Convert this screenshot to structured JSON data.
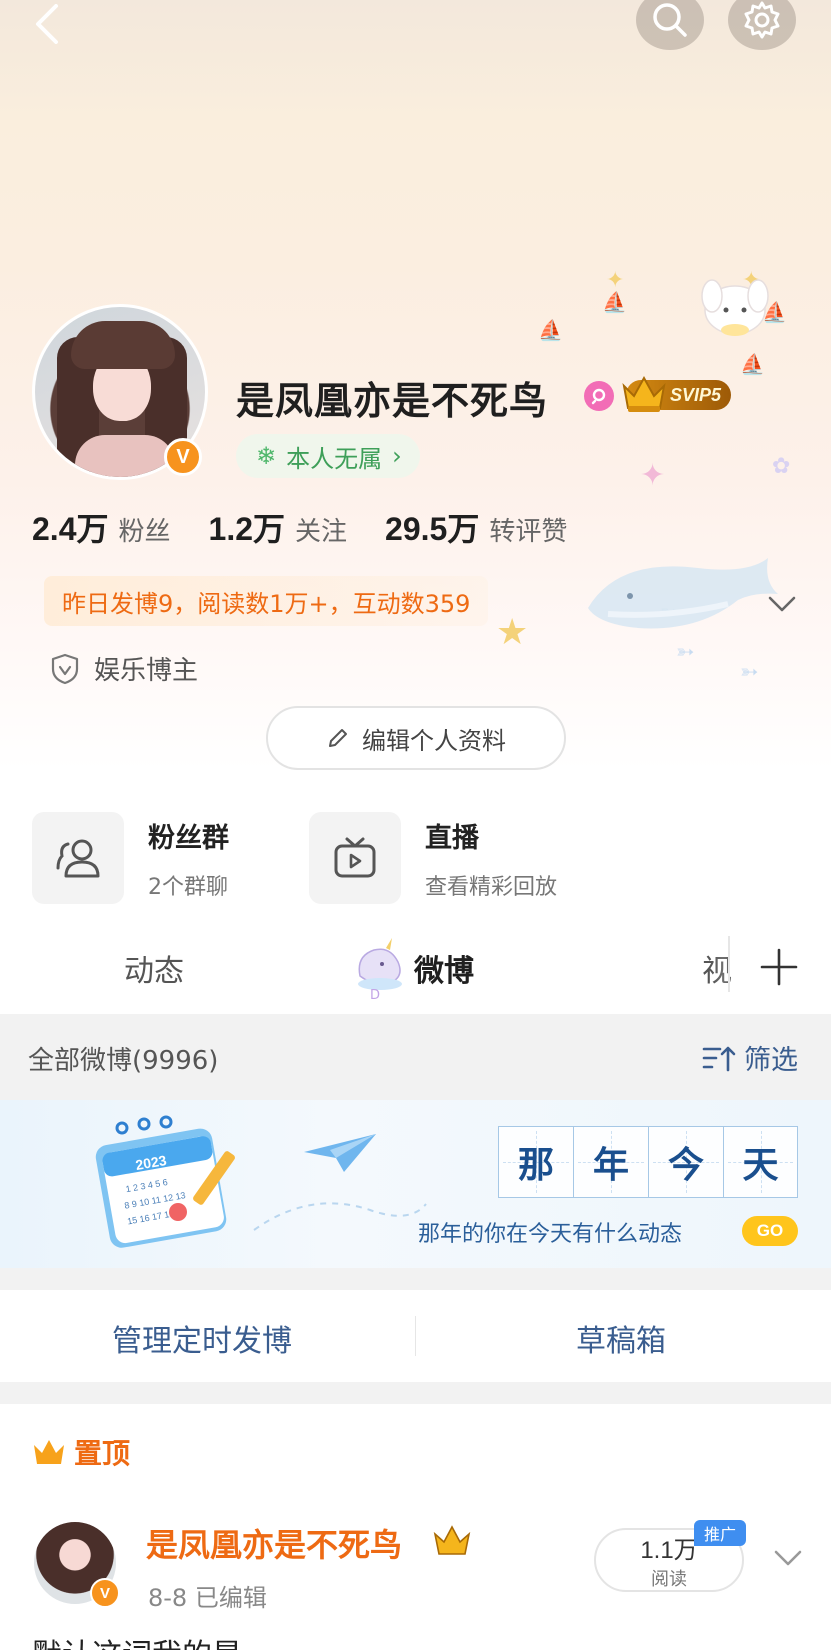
{
  "header": {
    "back_icon": "chevron-left-icon",
    "search_icon": "search-icon",
    "settings_icon": "gear-icon"
  },
  "profile": {
    "username": "是凤凰亦是不死鸟",
    "verified_badge": "V",
    "vip_badge": "SVIP5",
    "status": "本人无属",
    "status_arrow": "›",
    "stats": [
      {
        "num": "2.4万",
        "label": "粉丝"
      },
      {
        "num": "1.2万",
        "label": "关注"
      },
      {
        "num": "29.5万",
        "label": "转评赞"
      }
    ],
    "activity": "昨日发博9，阅读数1万+，互动数359",
    "category": "娱乐博主",
    "edit_label": "编辑个人资料"
  },
  "features": {
    "fans_group": {
      "title": "粉丝群",
      "sub": "2个群聊"
    },
    "live": {
      "title": "直播",
      "sub": "查看精彩回放"
    }
  },
  "tabs": {
    "dynamic": "动态",
    "weibo": "微博",
    "video": "视",
    "dots": "D"
  },
  "filter": {
    "title": "全部微博(9996)",
    "button": "筛选"
  },
  "throwback": {
    "chars": [
      "那",
      "年",
      "今",
      "天"
    ],
    "subtitle": "那年的你在今天有什么动态",
    "go": "GO",
    "calendar_year": "2023"
  },
  "actions": {
    "scheduled": "管理定时发博",
    "drafts": "草稿箱"
  },
  "pinned": {
    "label": "置顶",
    "author": "是凤凰亦是不死鸟",
    "meta": "8-8  已编辑",
    "reads_num": "1.1万",
    "reads_label": "阅读",
    "promo": "推广",
    "text": "默认这词我的是"
  },
  "colors": {
    "accent_orange": "#ee6a13",
    "link_blue": "#3a5d8f",
    "status_green": "#3e9f59",
    "vip_gold": "#d48a12"
  }
}
